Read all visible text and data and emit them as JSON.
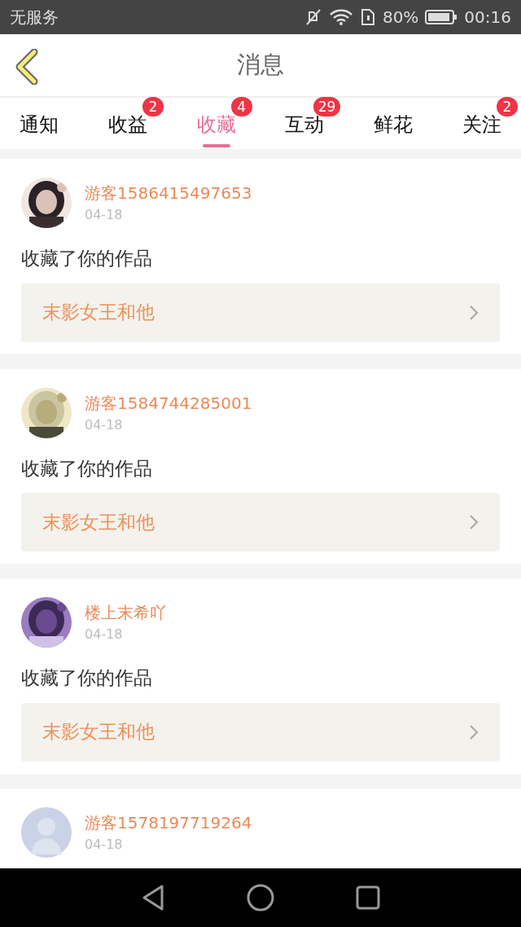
{
  "status_bar": {
    "carrier": "无服务",
    "battery": "80%",
    "time": "00:16"
  },
  "header": {
    "title": "消息"
  },
  "tabs": [
    {
      "label": "通知",
      "selected": false
    },
    {
      "label": "收益",
      "selected": false,
      "badge": "2"
    },
    {
      "label": "收藏",
      "selected": true,
      "badge": "4"
    },
    {
      "label": "互动",
      "selected": false,
      "badge": "29"
    },
    {
      "label": "鲜花",
      "selected": false
    },
    {
      "label": "关注",
      "selected": false,
      "badge": "2"
    }
  ],
  "messages": [
    {
      "user": "游客1586415497653",
      "date": "04-18",
      "text": "收藏了你的作品",
      "work": "末影女王和他"
    },
    {
      "user": "游客1584744285001",
      "date": "04-18",
      "text": "收藏了你的作品",
      "work": "末影女王和他"
    },
    {
      "user": "楼上末希吖",
      "date": "04-18",
      "text": "收藏了你的作品",
      "work": "末影女王和他"
    },
    {
      "avatar": {
        "kind": "default"
      },
      "user": "游客1578197719264",
      "date": "04-18"
    }
  ]
}
